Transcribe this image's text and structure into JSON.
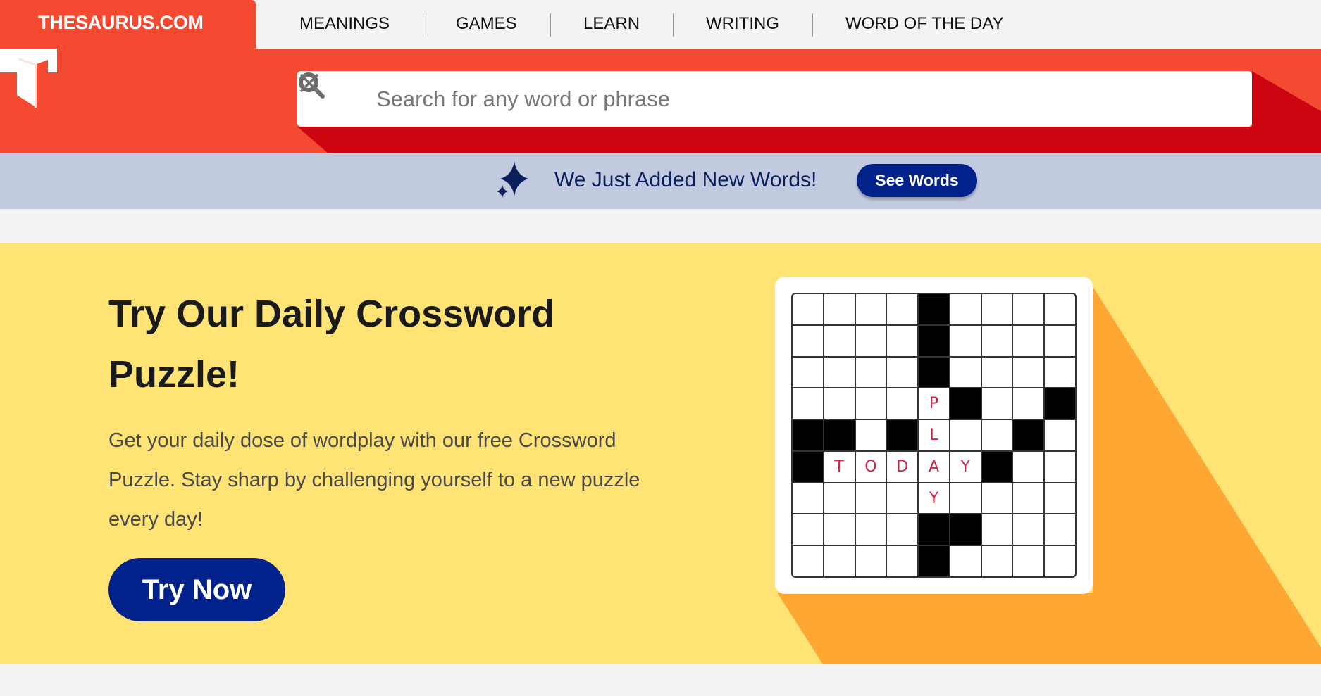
{
  "topnav": {
    "brand": "THESAURUS.COM",
    "items": [
      {
        "label": "MEANINGS"
      },
      {
        "label": "GAMES"
      },
      {
        "label": "LEARN"
      },
      {
        "label": "WRITING"
      },
      {
        "label": "WORD OF THE DAY"
      }
    ]
  },
  "header": {
    "logo_icon": "thesaurus-t-logo",
    "search": {
      "placeholder": "Search for any word or phrase",
      "value": "",
      "search_icon": "search-icon",
      "clear_icon": "close-icon"
    }
  },
  "banner": {
    "icon": "sparkle-icon",
    "text": "We Just Added New Words!",
    "button_label": "See Words"
  },
  "promo": {
    "title": "Try Our Daily Crossword Puzzle!",
    "body": "Get your daily dose of wordplay with our free Crossword Puzzle. Stay sharp by challenging yourself to a new puzzle every day!",
    "button_label": "Try Now",
    "crossword": {
      "rows": 9,
      "cols": 9,
      "black_cells": [
        [
          0,
          4
        ],
        [
          1,
          4
        ],
        [
          2,
          4
        ],
        [
          3,
          5
        ],
        [
          3,
          8
        ],
        [
          4,
          0
        ],
        [
          4,
          1
        ],
        [
          4,
          3
        ],
        [
          4,
          7
        ],
        [
          5,
          0
        ],
        [
          5,
          6
        ],
        [
          7,
          4
        ],
        [
          7,
          5
        ],
        [
          8,
          4
        ]
      ],
      "letters": [
        {
          "r": 3,
          "c": 4,
          "ch": "P"
        },
        {
          "r": 4,
          "c": 4,
          "ch": "L"
        },
        {
          "r": 5,
          "c": 1,
          "ch": "T"
        },
        {
          "r": 5,
          "c": 2,
          "ch": "O"
        },
        {
          "r": 5,
          "c": 3,
          "ch": "D"
        },
        {
          "r": 5,
          "c": 4,
          "ch": "A"
        },
        {
          "r": 5,
          "c": 5,
          "ch": "Y"
        },
        {
          "r": 6,
          "c": 4,
          "ch": "Y"
        }
      ]
    }
  },
  "colors": {
    "brand_red": "#f44a31",
    "dark_red": "#cc0510",
    "navy": "#01228a",
    "banner_bg": "#c2cae0",
    "promo_yellow": "#ffe475",
    "promo_orange": "#ffa733",
    "letter_red": "#d0254a"
  }
}
